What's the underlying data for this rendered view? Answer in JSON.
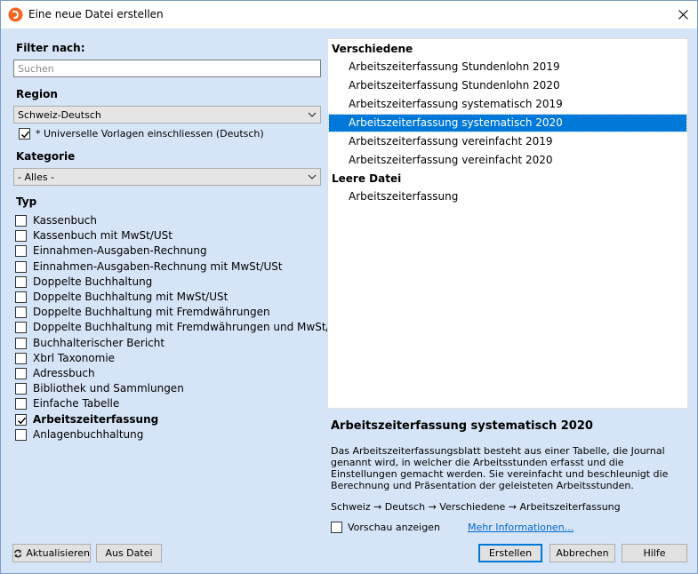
{
  "window": {
    "title": "Eine neue Datei erstellen",
    "close_label": "✕"
  },
  "filter": {
    "label": "Filter nach:",
    "search_placeholder": "Suchen",
    "search_value": ""
  },
  "region": {
    "label": "Region",
    "selected": "Schweiz-Deutsch",
    "universal_checkbox": {
      "label": "* Universelle Vorlagen einschliessen (Deutsch)",
      "checked": true
    }
  },
  "category": {
    "label": "Kategorie",
    "selected": "- Alles -"
  },
  "type": {
    "label": "Typ",
    "items": [
      {
        "label": "Kassenbuch",
        "checked": false
      },
      {
        "label": "Kassenbuch mit MwSt/USt",
        "checked": false
      },
      {
        "label": "Einnahmen-Ausgaben-Rechnung",
        "checked": false
      },
      {
        "label": "Einnahmen-Ausgaben-Rechnung mit MwSt/USt",
        "checked": false
      },
      {
        "label": "Doppelte Buchhaltung",
        "checked": false
      },
      {
        "label": "Doppelte Buchhaltung mit MwSt/USt",
        "checked": false
      },
      {
        "label": "Doppelte Buchhaltung mit Fremdwährungen",
        "checked": false
      },
      {
        "label": "Doppelte Buchhaltung mit Fremdwährungen und MwSt/USt",
        "checked": false
      },
      {
        "label": "Buchhalterischer Bericht",
        "checked": false
      },
      {
        "label": "Xbrl Taxonomie",
        "checked": false
      },
      {
        "label": "Adressbuch",
        "checked": false
      },
      {
        "label": "Bibliothek und Sammlungen",
        "checked": false
      },
      {
        "label": "Einfache Tabelle",
        "checked": false
      },
      {
        "label": "Arbeitszeiterfassung",
        "checked": true
      },
      {
        "label": "Anlagenbuchhaltung",
        "checked": false
      }
    ]
  },
  "templates": {
    "groups": [
      {
        "name": "Verschiedene",
        "items": [
          {
            "label": "Arbeitszeiterfassung Stundenlohn 2019",
            "selected": false
          },
          {
            "label": "Arbeitszeiterfassung Stundenlohn 2020",
            "selected": false
          },
          {
            "label": "Arbeitszeiterfassung systematisch 2019",
            "selected": false
          },
          {
            "label": "Arbeitszeiterfassung systematisch 2020",
            "selected": true
          },
          {
            "label": "Arbeitszeiterfassung vereinfacht 2019",
            "selected": false
          },
          {
            "label": "Arbeitszeiterfassung vereinfacht 2020",
            "selected": false
          }
        ]
      },
      {
        "name": "Leere Datei",
        "items": [
          {
            "label": "Arbeitszeiterfassung",
            "selected": false
          }
        ]
      }
    ]
  },
  "detail": {
    "title": "Arbeitszeiterfassung systematisch 2020",
    "description": "Das Arbeitszeiterfassungsblatt besteht aus einer Tabelle, die Journal genannt wird, in welcher die Arbeitsstunden erfasst und die Einstellungen gemacht werden. Sie vereinfacht und beschleunigt die Berechnung und Präsentation der geleisteten Arbeitsstunden.",
    "path": "Schweiz → Deutsch → Verschiedene → Arbeitszeiterfassung",
    "preview_label": "Vorschau anzeigen",
    "preview_checked": false,
    "more_info_label": "Mehr Informationen..."
  },
  "buttons": {
    "refresh": "Aktualisieren",
    "from_file": "Aus Datei",
    "create": "Erstellen",
    "cancel": "Abbrechen",
    "help": "Hilfe"
  },
  "colors": {
    "dialog_bg": "#d6e4f7",
    "selection": "#0078d7",
    "link": "#0066cc"
  }
}
